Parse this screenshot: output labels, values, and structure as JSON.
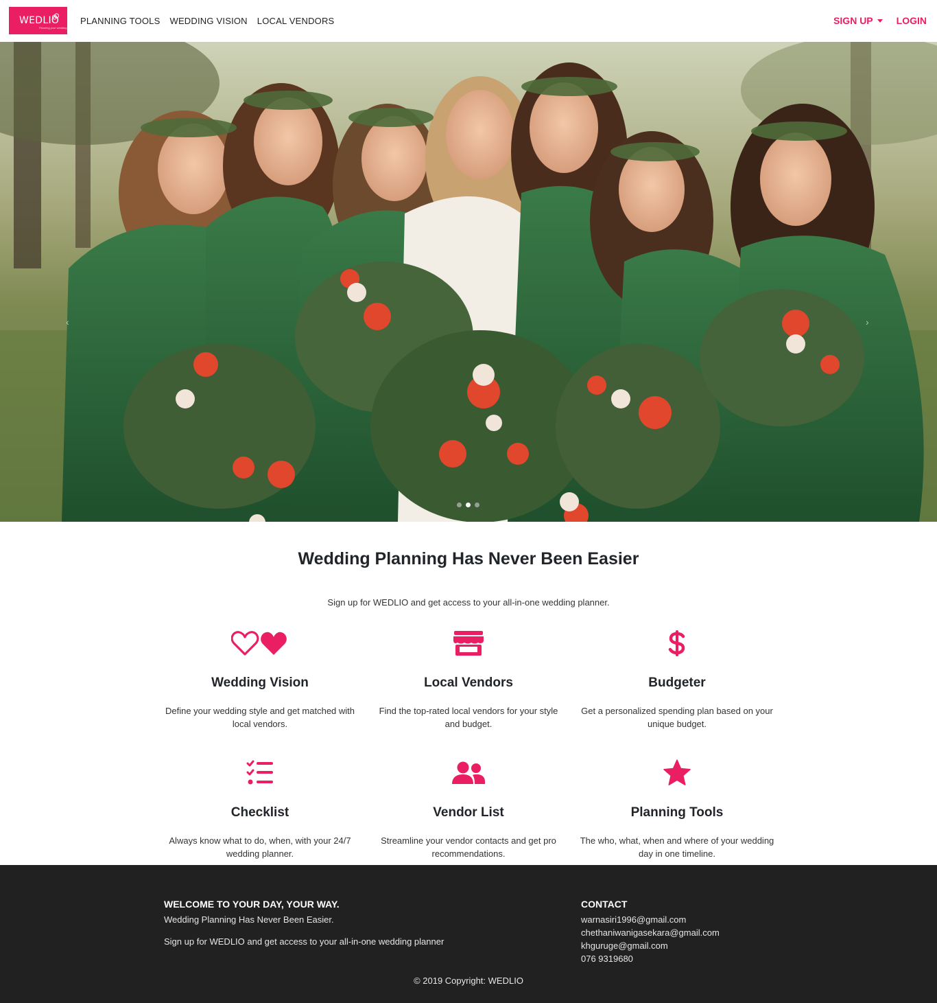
{
  "nav": {
    "logo_text": "WEDLIO",
    "logo_tagline": "Planning your wedding",
    "links": [
      "PLANNING TOOLS",
      "WEDDING VISION",
      "LOCAL VENDORS"
    ],
    "sign_up": "SIGN UP",
    "login": "LOGIN"
  },
  "hero": {
    "carousel_prev": "‹",
    "carousel_next": "›",
    "slides": 3,
    "active_slide": 2
  },
  "intro": {
    "title": "Wedding Planning Has Never Been Easier",
    "subtitle": "Sign up for WEDLIO and get access to your all-in-one wedding planner."
  },
  "features": [
    {
      "icon": "hearts-icon",
      "title": "Wedding Vision",
      "desc": "Define your wedding style and get matched with local vendors."
    },
    {
      "icon": "store-icon",
      "title": "Local Vendors",
      "desc": "Find the top-rated local vendors for your style and budget."
    },
    {
      "icon": "dollar-icon",
      "title": "Budgeter",
      "desc": "Get a personalized spending plan based on your unique budget."
    },
    {
      "icon": "checklist-icon",
      "title": "Checklist",
      "desc": "Always know what to do, when, with your 24/7 wedding planner."
    },
    {
      "icon": "users-icon",
      "title": "Vendor List",
      "desc": "Streamline your vendor contacts and get pro recommendations."
    },
    {
      "icon": "star-icon",
      "title": "Planning Tools",
      "desc": "The who, what, when and where of your wedding day in one timeline."
    }
  ],
  "footer": {
    "welcome_heading": "WELCOME TO YOUR DAY, YOUR WAY.",
    "welcome_line1": "Wedding Planning Has Never Been Easier.",
    "welcome_line2": "Sign up for WEDLIO and get access to your all-in-one wedding planner",
    "contact_heading": "CONTACT",
    "contacts": [
      "warnasiri1996@gmail.com",
      "chethaniwanigasekara@gmail.com",
      "khguruge@gmail.com",
      "076 9319680"
    ],
    "copyright": "© 2019 Copyright: WEDLIO"
  },
  "colors": {
    "accent": "#e91e63",
    "footer_bg": "#212121",
    "dress_green": "#2f6b3e"
  }
}
